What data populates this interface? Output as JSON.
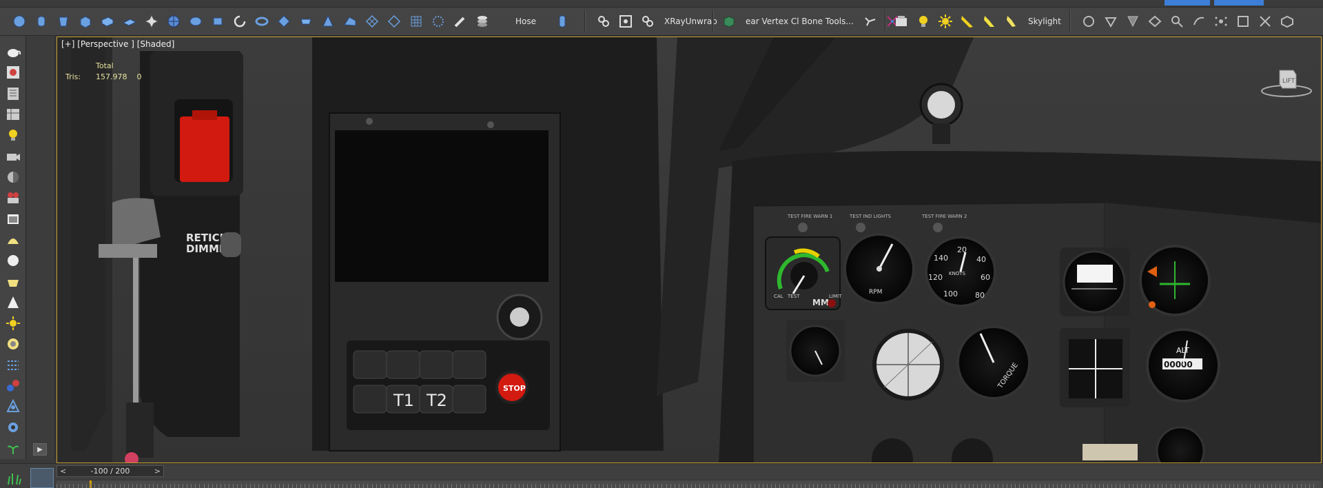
{
  "toolbar": {
    "hose_label": "Hose",
    "xray_label": "XRayUnwrap",
    "bone_tools_label": "ear Vertex Cl Bone Tools...",
    "skylight_label": "Skylight"
  },
  "viewport": {
    "label": "[+] [Perspective ] [Shaded]",
    "stats_header": "Total",
    "stats_label": "Tris:",
    "stats_total": "157.978",
    "stats_selected": "0",
    "viewcube_label": "LIFT"
  },
  "scene_text": {
    "reticle_line1": "RETICLE",
    "reticle_line2": "DIMMER",
    "key_t1": "T1",
    "key_t2": "T2",
    "key_stop": "STOP",
    "test_fire_warn_1": "TEST FIRE WARN 1",
    "test_ind_lights": "TEST IND LIGHTS",
    "test_fire_warn_2": "TEST FIRE WARN 2",
    "gauge_mm": "MM",
    "gauge_cal": "CAL",
    "gauge_test": "TEST",
    "gauge_limit": "LIMIT",
    "gauge_rpm": "RPM",
    "gauge_knots": "KNOTS",
    "gauge_torque": "TORQUE",
    "gauge_alt": "ALT",
    "alt_counter": "00000",
    "airspeed_140": "140",
    "airspeed_120": "120",
    "airspeed_100": "100",
    "airspeed_80": "80",
    "airspeed_60": "60",
    "airspeed_40": "40",
    "airspeed_20": "20"
  },
  "timeline": {
    "frame_label": "-100 / 200",
    "prev_arrow": "<",
    "next_arrow": ">"
  },
  "colors": {
    "accent_gold": "#c8a030",
    "time_cursor": "#d8a000",
    "red_switch": "#d21a10",
    "gauge_green": "#2eb82e",
    "gauge_yellow": "#e8d000"
  }
}
